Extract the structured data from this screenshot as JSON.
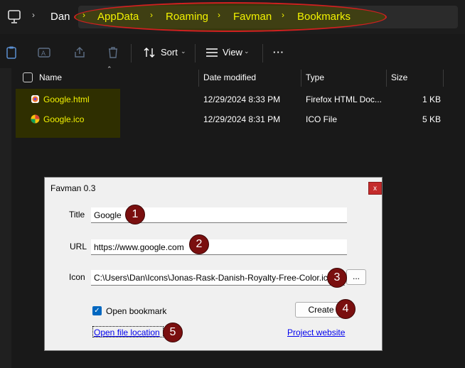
{
  "breadcrumb": {
    "user": "Dan",
    "items": [
      "AppData",
      "Roaming",
      "Favman",
      "Bookmarks"
    ]
  },
  "toolbar": {
    "sort_label": "Sort",
    "view_label": "View",
    "more_label": "···"
  },
  "file_list": {
    "columns": [
      "Name",
      "Date modified",
      "Type",
      "Size"
    ],
    "rows": [
      {
        "name": "Google.html",
        "date": "12/29/2024 8:33 PM",
        "type": "Firefox HTML Doc...",
        "size": "1 KB",
        "icon": "firefox-html-icon"
      },
      {
        "name": "Google.ico",
        "date": "12/29/2024 8:31 PM",
        "type": "ICO File",
        "size": "5 KB",
        "icon": "ico-file-icon"
      }
    ]
  },
  "dialog": {
    "title": "Favman 0.3",
    "close": "x",
    "title_label": "Title",
    "title_value": "Google",
    "url_label": "URL",
    "url_value": "https://www.google.com",
    "icon_label": "Icon",
    "icon_value": "C:\\Users\\Dan\\Icons\\Jonas-Rask-Danish-Royalty-Free-Color.ico",
    "browse_label": "...",
    "open_bookmark_label": "Open bookmark",
    "open_bookmark_checked": true,
    "create_label": "Create",
    "open_file_location": "Open file location",
    "project_website": "Project website"
  },
  "annotations": [
    "1",
    "2",
    "3",
    "4",
    "5"
  ],
  "colors": {
    "highlight": "#f2f200",
    "annotation_ring": "#d02020",
    "badge": "#7a0f0f"
  }
}
